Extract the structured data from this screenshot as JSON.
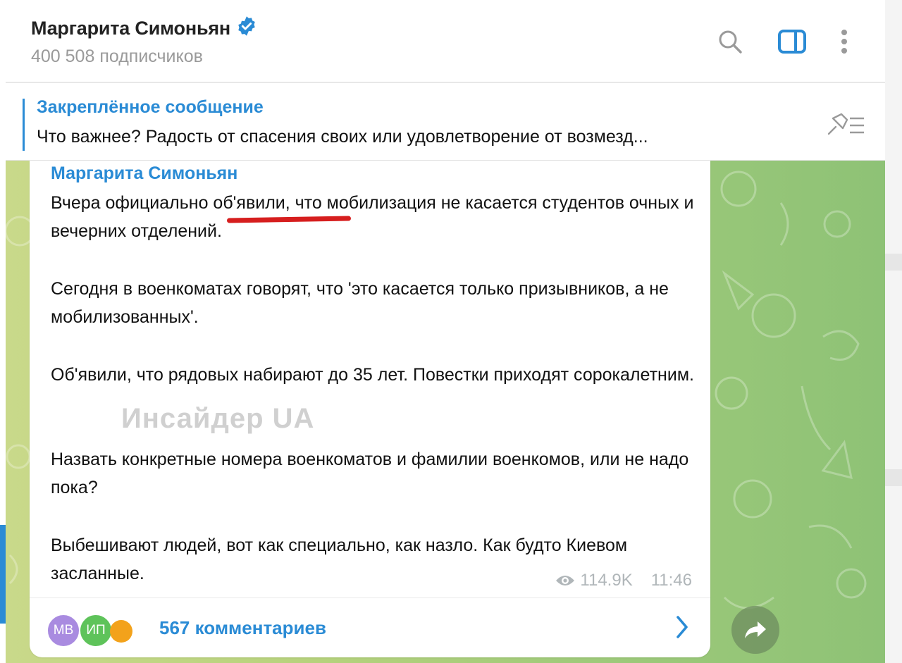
{
  "header": {
    "title": "Маргарита Симоньян",
    "subscribers": "400 508 подписчиков",
    "icons": [
      "verified-icon",
      "search-icon",
      "sidebar-toggle-icon",
      "more-icon"
    ],
    "accent_color": "#2a8bd5"
  },
  "pinned": {
    "label": "Закреплённое сообщение",
    "text": "Что важнее? Радость от спасения своих или удовлетворение от возмезд..."
  },
  "message": {
    "sender": "Маргарита Симоньян",
    "paragraphs": [
      "Вчера официально об'явили, что мобилизация не касается студентов очных и вечерних отделений.",
      "Сегодня в военкоматах говорят, что 'это касается только призывников, а не мобилизованных'.",
      "Об'явили, что рядовых набирают до 35 лет. Повестки приходят сорокалетним.",
      "Назвать конкретные номера военкоматов и фамилии военкомов, или не надо пока?",
      "Выбешивают людей, вот как специально, как назло. Как будто Киевом засланные."
    ],
    "watermark": "Инсайдер UA",
    "views": "114.9K",
    "time": "11:46",
    "comments": {
      "avatars": [
        "МВ",
        "ИП"
      ],
      "label": "567 комментариев"
    }
  }
}
